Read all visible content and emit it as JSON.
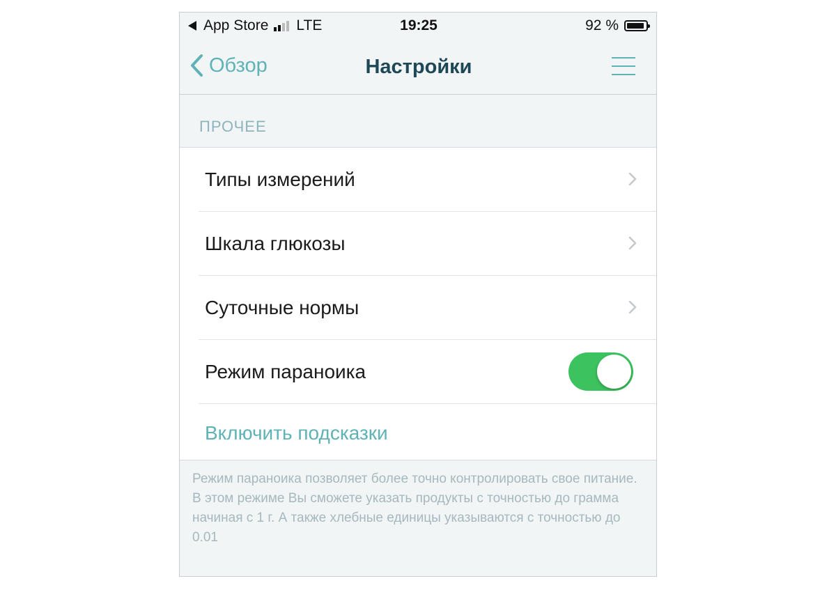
{
  "status_bar": {
    "back_app": "App Store",
    "network": "LTE",
    "time": "19:25",
    "battery_percent": "92 %",
    "battery_level": 0.92
  },
  "nav": {
    "back_label": "Обзор",
    "title": "Настройки"
  },
  "section": {
    "header": "ПРОЧЕЕ",
    "items": [
      {
        "label": "Типы измерений"
      },
      {
        "label": "Шкала глюкозы"
      },
      {
        "label": "Суточные нормы"
      },
      {
        "label": "Режим параноика",
        "toggle_on": true
      },
      {
        "label": "Включить подсказки"
      }
    ],
    "footer": "Режим параноика позволяет более точно контролировать свое питание. В этом режиме Вы сможете указать продукты с точностью до грамма начиная с 1 г. А также хлебные единицы указываются с точностью до 0.01"
  },
  "colors": {
    "accent": "#5fb2b5",
    "title": "#1f4857",
    "toggle_on": "#3cc25f",
    "background": "#f1f5f6"
  }
}
